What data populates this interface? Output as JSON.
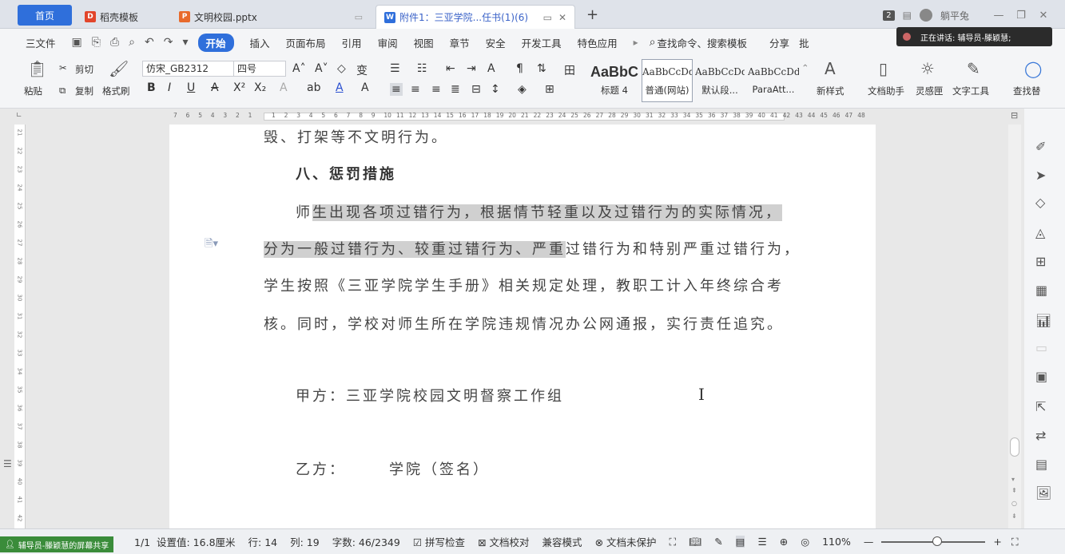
{
  "tabs": {
    "home": "首页",
    "t2": "稻壳模板",
    "t3": "文明校园.pptx",
    "active": "附件1：三亚学院...任书(1)(6)",
    "icon_t2": "D",
    "icon_t3": "P",
    "icon_active": "W"
  },
  "titlebar": {
    "badge": "2",
    "user": "躺平兔"
  },
  "menu": {
    "file": "三文件",
    "items": [
      "开始",
      "插入",
      "页面布局",
      "引用",
      "审阅",
      "视图",
      "章节",
      "安全",
      "开发工具",
      "特色应用"
    ],
    "search": "查找命令、搜索模板",
    "share": "分享",
    "batch": "批"
  },
  "meeting": {
    "speaking": "正在讲话: 辅导员-滕颖慧;"
  },
  "ribbon": {
    "paste": "粘贴",
    "cut": "剪切",
    "copy": "复制",
    "format_painter": "格式刷",
    "font_name": "仿宋_GB2312",
    "font_size": "四号",
    "styles": [
      {
        "sample": "AaBbC",
        "name": "标题 4"
      },
      {
        "sample": "AaBbCcDd",
        "name": "普通(网站)"
      },
      {
        "sample": "AaBbCcDd",
        "name": "默认段..."
      },
      {
        "sample": "AaBbCcDd",
        "name": "ParaAtt..."
      }
    ],
    "new_style": "新样式",
    "doc_helper": "文档助手",
    "inspiration": "灵感匣",
    "text_tools": "文字工具",
    "find_replace": "查找替"
  },
  "ruler": {
    "left_numbers": [
      "7",
      "6",
      "5",
      "4",
      "3",
      "2",
      "1"
    ],
    "numbers": [
      "1",
      "2",
      "3",
      "4",
      "5",
      "6",
      "7",
      "8",
      "9",
      "10",
      "11",
      "12",
      "13",
      "14",
      "15",
      "16",
      "17",
      "18",
      "19",
      "20",
      "21",
      "22",
      "23",
      "24",
      "25",
      "26",
      "27",
      "28",
      "29",
      "30",
      "31",
      "32",
      "33",
      "34",
      "35",
      "36",
      "37",
      "38",
      "39",
      "40",
      "41",
      "42",
      "43",
      "44",
      "45",
      "46",
      "47",
      "48"
    ]
  },
  "vruler": {
    "numbers": [
      "21",
      "22",
      "23",
      "24",
      "25",
      "26",
      "27",
      "28",
      "29",
      "30",
      "31",
      "32",
      "33",
      "34",
      "35",
      "36",
      "37",
      "38",
      "39",
      "40",
      "41",
      "42"
    ]
  },
  "document": {
    "line0": "毁、打架等不文明行为。",
    "heading": "八、惩罚措施",
    "p1_lead": "师",
    "p1_hl": "生出现各项过错行为，根据情节轻重以及过错行为的实际情况，",
    "p2_hl": "分为一般过错行为、较重过错行为、严重",
    "p2_rest": "过错行为和特别严重过错行为，",
    "p3": "学生按照《三亚学院学生手册》相关规定处理，教职工计入年终综合考",
    "p4": "核。同时，学校对师生所在学院违规情况办公网通报，实行责任追究。",
    "party_a": "甲方：三亚学院校园文明督察工作组",
    "party_b": "乙方：　　　学院（签名）"
  },
  "statusbar": {
    "screen_share": "辅导员-滕颖慧的屏幕共享",
    "page_no": "1/1",
    "setting": "设置值: 16.8厘米",
    "row": "行: 14",
    "col": "列: 19",
    "words": "字数: 46/2349",
    "spell": "拼写检查",
    "proofread": "文档校对",
    "compat": "兼容模式",
    "unprotected": "文档未保护",
    "zoom": "110%"
  }
}
